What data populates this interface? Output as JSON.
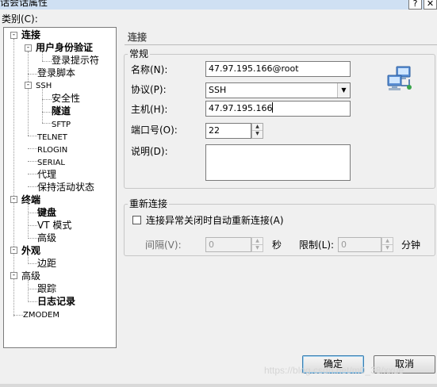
{
  "window": {
    "title": "话会话属性",
    "help": "?",
    "close": "✕"
  },
  "category_label": "类别(C):",
  "tree": {
    "connection": "连接",
    "auth": "用户身份验证",
    "login_prompt": "登录提示符",
    "login_script": "登录脚本",
    "ssh": "SSH",
    "security": "安全性",
    "tunnel": "隧道",
    "sftp": "SFTP",
    "telnet": "TELNET",
    "rlogin": "RLOGIN",
    "serial": "SERIAL",
    "proxy": "代理",
    "keepalive": "保持活动状态",
    "terminal": "终端",
    "keyboard": "键盘",
    "vt_mode": "VT 模式",
    "advanced_terminal": "高级",
    "appearance": "外观",
    "margins": "边距",
    "advanced": "高级",
    "tracking": "跟踪",
    "logging": "日志记录",
    "zmodem": "ZMODEM"
  },
  "panel": {
    "title": "连接",
    "general_group": "常规",
    "name_label": "名称(N):",
    "name_value": "47.97.195.166@root",
    "protocol_label": "协议(P):",
    "protocol_value": "SSH",
    "host_label": "主机(H):",
    "host_value": "47.97.195.166",
    "port_label": "端口号(O):",
    "port_value": "22",
    "desc_label": "说明(D):",
    "desc_value": "",
    "reconnect_group": "重新连接",
    "reconnect_checkbox": "连接异常关闭时自动重新连接(A)",
    "reconnect_checked": false,
    "interval_label": "间隔(V):",
    "interval_value": "0",
    "seconds_unit": "秒",
    "limit_label": "限制(L):",
    "limit_value": "0",
    "minutes_unit": "分钟"
  },
  "buttons": {
    "ok": "确定",
    "cancel": "取消"
  },
  "watermark": "https://blog.csdn.net/m0_38/xxue",
  "icons": {
    "session-icon": "network-computers-icon",
    "expander-open": "minus",
    "spin-up": "▲",
    "spin-down": "▼",
    "dropdown": "▼"
  }
}
